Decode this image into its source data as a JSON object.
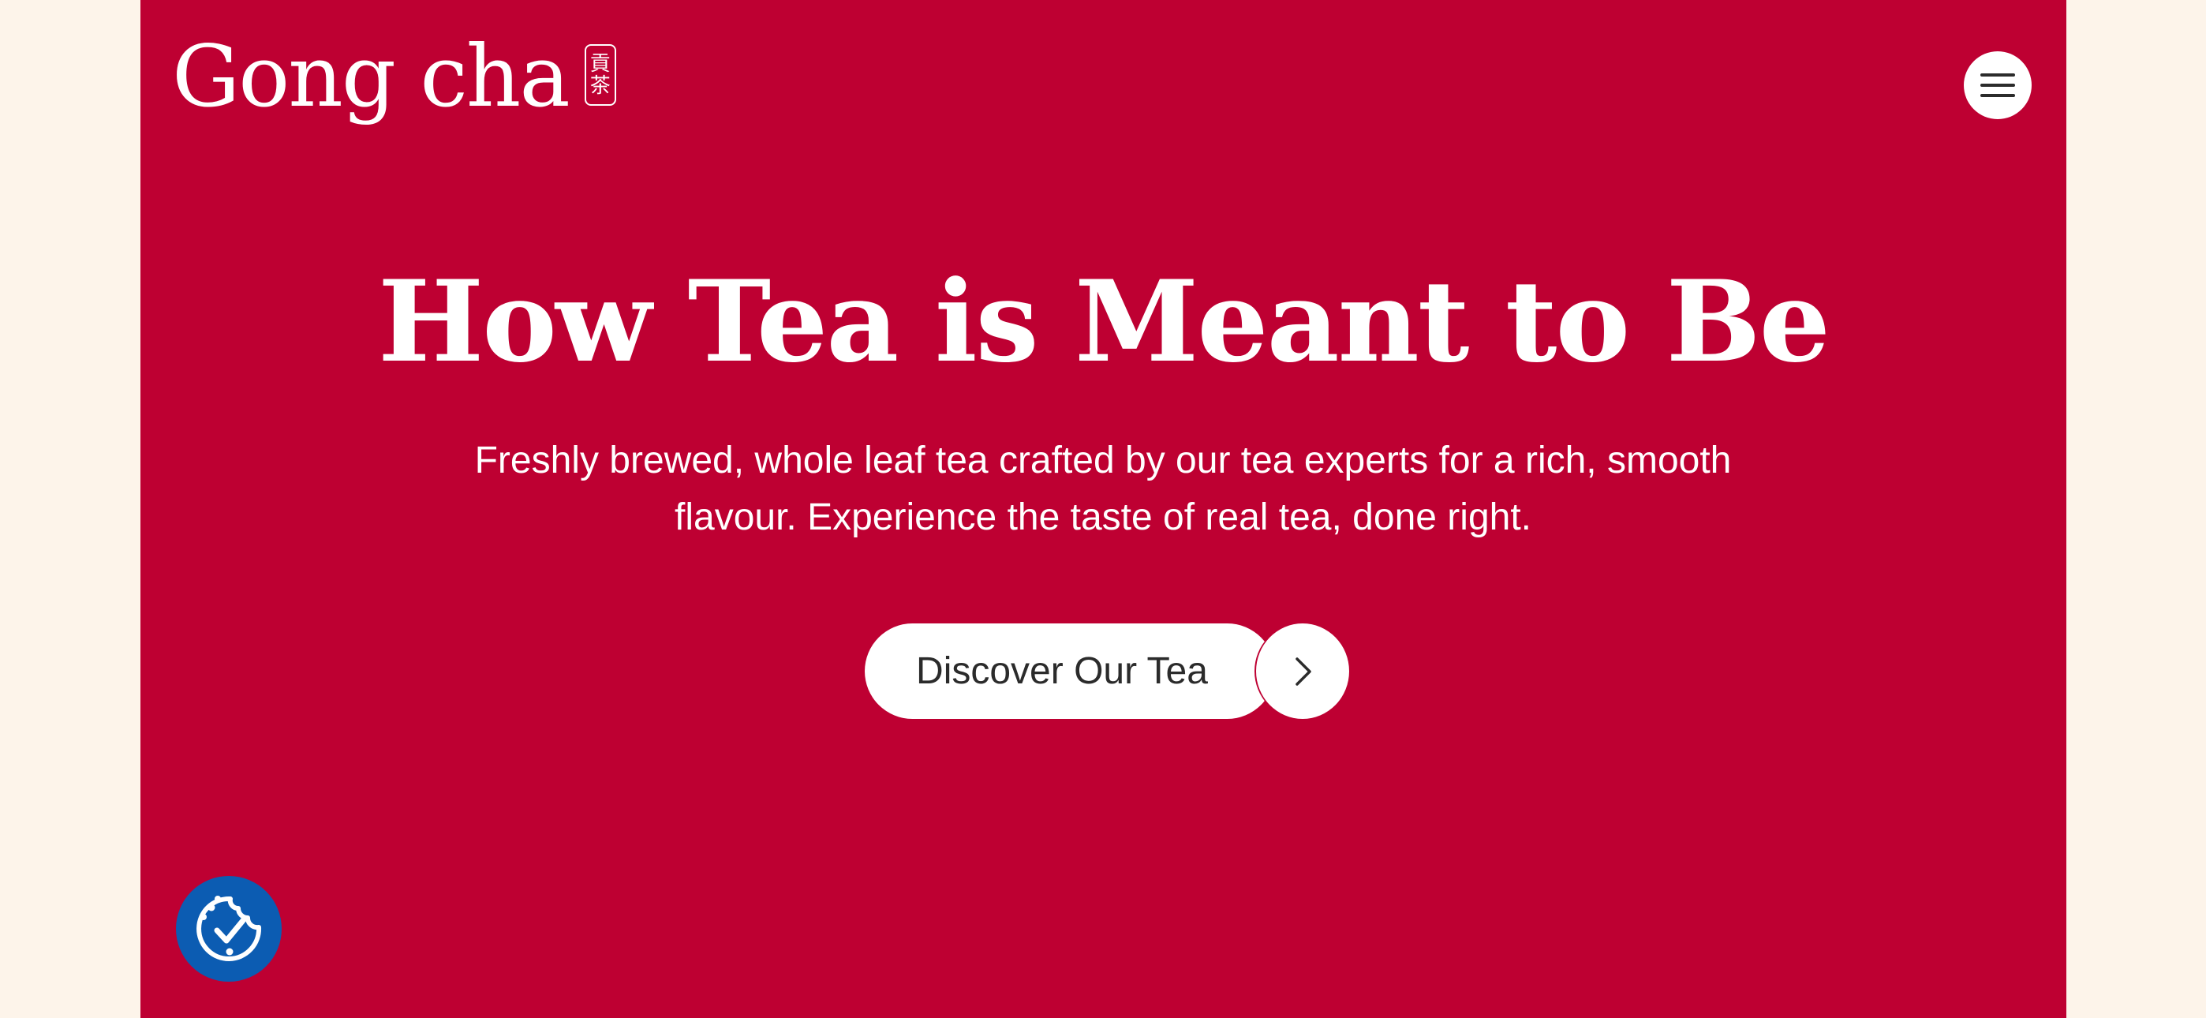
{
  "brand": {
    "name": "Gong cha",
    "seal_chars": [
      "貢",
      "茶"
    ]
  },
  "header": {
    "menu_icon": "hamburger-menu-icon"
  },
  "hero": {
    "headline": "How Tea is Meant to Be",
    "description": "Freshly brewed, whole leaf tea crafted by our tea experts for a rich, smooth flavour. Experience the taste of real tea, done right.",
    "cta_label": "Discover Our Tea",
    "cta_icon": "chevron-right-icon"
  },
  "cookie_consent": {
    "icon": "cookie-check-icon"
  },
  "colors": {
    "page_background": "#fdf4ea",
    "brand_red": "#be0032",
    "white": "#ffffff",
    "text_dark": "#2b2b2b",
    "cookie_blue": "#0c5cb2"
  }
}
